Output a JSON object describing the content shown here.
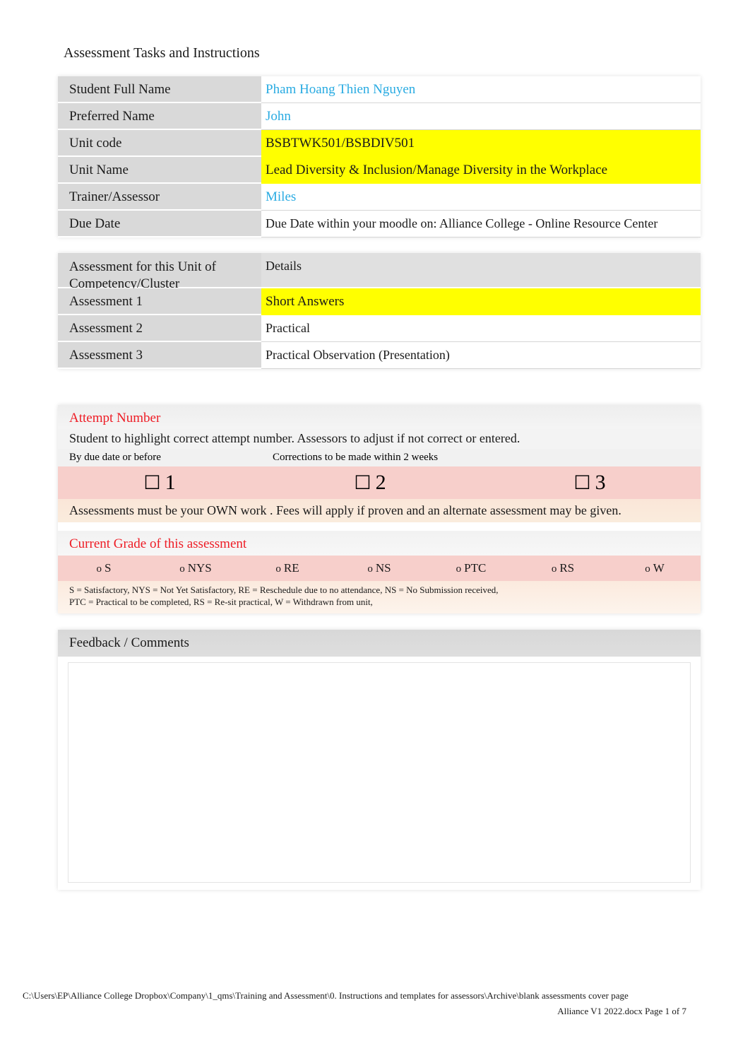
{
  "document": {
    "title": "Assessment Tasks and Instructions"
  },
  "student_table": {
    "rows": [
      {
        "label": "Student Full Name",
        "value": "Pham Hoang Thien Nguyen",
        "style": "blue"
      },
      {
        "label": "Preferred Name",
        "value": "John",
        "style": "blue"
      },
      {
        "label": "Unit code",
        "value": "BSBTWK501/BSBDIV501",
        "style": "highlight"
      },
      {
        "label": "Unit Name",
        "value": "Lead Diversity & Inclusion/Manage Diversity in the Workplace",
        "style": "highlight"
      },
      {
        "label": "Trainer/Assessor",
        "value": "Miles",
        "style": "blue"
      },
      {
        "label": "Due Date",
        "value": "Due Date within your moodle on: Alliance College - Online Resource Center",
        "style": "plain"
      }
    ]
  },
  "assessment_table": {
    "rows": [
      {
        "label": "Assessment for this Unit of Competency/Cluster",
        "value": "Details",
        "style": "header"
      },
      {
        "label": "Assessment 1",
        "value": "Short Answers",
        "style": "highlight"
      },
      {
        "label": "Assessment 2",
        "value": "Practical",
        "style": "plain"
      },
      {
        "label": "Assessment 3",
        "value": "Practical Observation (Presentation)",
        "style": "plain"
      }
    ]
  },
  "attempt": {
    "heading": "Attempt Number",
    "instruction": "Student to highlight correct attempt number. Assessors to adjust if not correct or entered.",
    "col_note_1": "By due date or before",
    "col_note_2": "Corrections to be made within 2 weeks",
    "col_note_3": "",
    "checkbox_glyph": "☐",
    "options": [
      "1",
      "2",
      "3"
    ],
    "own_work_note": "Assessments must be your OWN work . Fees will apply if proven and an alternate assessment may be given."
  },
  "grade": {
    "heading": "Current Grade of this assessment",
    "radio_glyph": "o",
    "options": [
      "S",
      "NYS",
      "RE",
      "NS",
      "PTC",
      "RS",
      "W"
    ],
    "legend_line_1": "S = Satisfactory, NYS = Not Yet Satisfactory, RE = Reschedule due to no attendance, NS = No Submission received,",
    "legend_line_2": "PTC = Practical to be completed, RS = Re-sit practical, W = Withdrawn from unit,"
  },
  "feedback": {
    "heading": "Feedback / Comments",
    "body": ""
  },
  "footer": {
    "line_1": "C:\\Users\\EP\\Alliance College Dropbox\\Company\\1_qms\\Training and Assessment\\0. Instructions and templates for assessors\\Archive\\blank assessments cover page",
    "line_2": "Alliance V1 2022.docx   Page 1 of 7"
  },
  "colors": {
    "accent_blue": "#29abe2",
    "highlight_yellow": "#ffff00",
    "heading_red": "#ee1c25",
    "label_grey": "#d9d9d9",
    "attempt_pink": "#f7cfcb",
    "own_work_cream": "#faecdd"
  }
}
